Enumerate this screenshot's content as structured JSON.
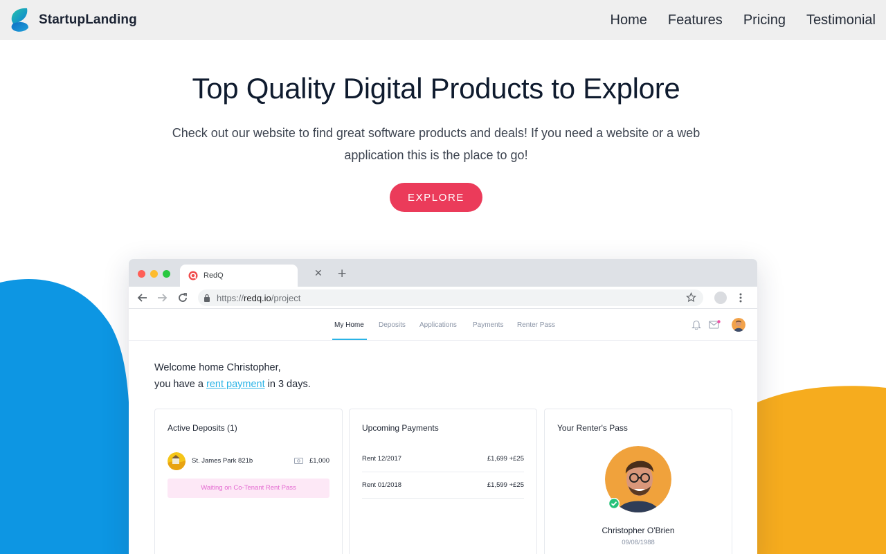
{
  "header": {
    "brand_name": "StartupLanding",
    "brand_logo_icon": "leaf-logo-icon",
    "nav": [
      {
        "label": "Home"
      },
      {
        "label": "Features"
      },
      {
        "label": "Pricing"
      },
      {
        "label": "Testimonial"
      }
    ]
  },
  "hero": {
    "title": "Top Quality Digital Products to Explore",
    "subtitle": "Check out our website to find great software products and deals! If you need a website or a web application this is the place to go!",
    "cta_label": "EXPLORE"
  },
  "colors": {
    "accent": "#eb3b5a",
    "blob_blue": "#0d96e3",
    "blob_orange": "#f6ac1e",
    "link": "#2ab3e6",
    "topbar_bg": "#efefef"
  },
  "browser": {
    "tab_title": "RedQ",
    "url": {
      "scheme": "https://",
      "host": "redq.io",
      "path": "/project"
    },
    "app_nav": [
      {
        "label": "My Home",
        "active": true
      },
      {
        "label": "Deposits",
        "active": false
      },
      {
        "label": "Applications",
        "active": false
      },
      {
        "label": "Payments",
        "active": false
      },
      {
        "label": "Renter Pass",
        "active": false
      }
    ],
    "welcome": {
      "line1": "Welcome home Christopher,",
      "line2_prefix": "you have a ",
      "link": "rent payment",
      "line2_suffix": " in 3 days."
    },
    "cards": {
      "deposits": {
        "title": "Active Deposits (1)",
        "item_name": "St. James Park 821b",
        "item_amount": "£1,000",
        "status": "Waiting on Co-Tenant Rent Pass"
      },
      "payments": {
        "title": "Upcoming Payments",
        "rows": [
          {
            "label": "Rent 12/2017",
            "amount": "£1,699  +£25"
          },
          {
            "label": "Rent 01/2018",
            "amount": "£1,599  +£25"
          }
        ]
      },
      "pass": {
        "title": "Your Renter's Pass",
        "name": "Christopher O'Brien",
        "dob": "09/08/1988"
      }
    }
  }
}
